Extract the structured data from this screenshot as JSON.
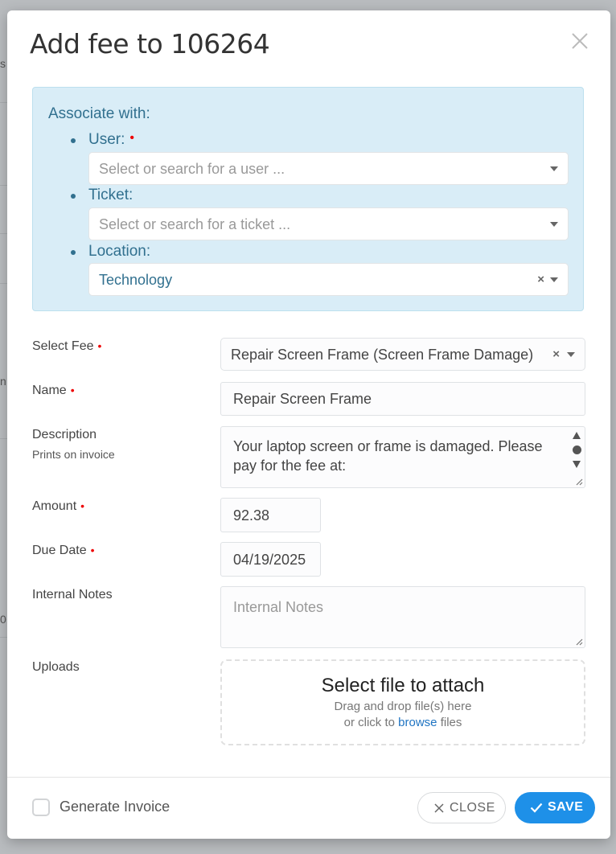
{
  "background": {
    "hint_top": "s",
    "hint_mid": "n",
    "hint_low": "0"
  },
  "modal": {
    "title": "Add fee to 106264",
    "close_icon": "close-icon"
  },
  "associate": {
    "heading": "Associate with:",
    "user": {
      "label": "User:",
      "required_mark": "•",
      "placeholder": "Select or search for a user ..."
    },
    "ticket": {
      "label": "Ticket:",
      "placeholder": "Select or search for a ticket ..."
    },
    "location": {
      "label": "Location:",
      "value": "Technology",
      "clear": "×"
    }
  },
  "form": {
    "select_fee": {
      "label": "Select Fee",
      "required_mark": "•",
      "value": "Repair Screen Frame (Screen Frame Damage)",
      "clear": "×"
    },
    "name": {
      "label": "Name",
      "required_mark": "•",
      "value": "Repair Screen Frame"
    },
    "description": {
      "label": "Description",
      "sublabel": "Prints on invoice",
      "value_line1": "Your laptop screen or frame is damaged. Please",
      "value_line2": "pay for the fee at:"
    },
    "amount": {
      "label": "Amount",
      "required_mark": "•",
      "value": "92.38"
    },
    "due_date": {
      "label": "Due Date",
      "required_mark": "•",
      "value": "04/19/2025"
    },
    "internal_notes": {
      "label": "Internal Notes",
      "placeholder": "Internal Notes"
    },
    "uploads": {
      "label": "Uploads",
      "title": "Select file to attach",
      "line1": "Drag and drop file(s) here",
      "line2_prefix": "or click to",
      "browse": "browse",
      "line2_suffix": "files"
    }
  },
  "footer": {
    "generate_invoice": "Generate Invoice",
    "close_label": "CLOSE",
    "save_label": "SAVE",
    "save_color": "#1e90e8"
  }
}
